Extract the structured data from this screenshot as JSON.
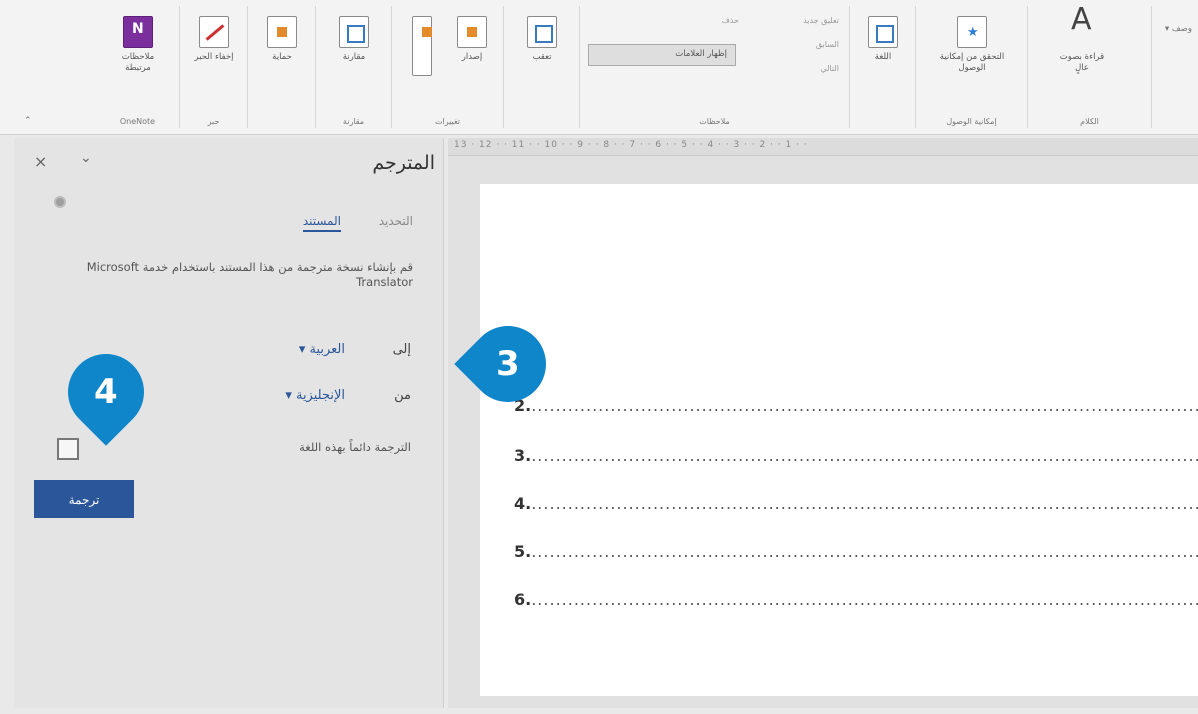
{
  "ribbon": {
    "buttons": {
      "linked_notes": "ملاحظات مرتبطة",
      "hide_ink": "إخفاء الحبر",
      "protect": "حماية",
      "compare": "مقارنة",
      "versions": "إصدار",
      "check": "تعقب",
      "language": "اللغة",
      "accessibility_check": "التحقق من إمكانية الوصول",
      "read_aloud": "قراءة بصوت عالٍ"
    },
    "filter_dropdown": "إظهار العلامات",
    "small_items": [
      "تعليق جديد",
      "حذف",
      "السابق",
      "التالي"
    ],
    "group_labels": {
      "onenote": "OneNote",
      "ink": "حبر",
      "compare": "مقارنة",
      "changes": "تغييرات",
      "comments": "ملاحظات",
      "accessibility": "إمكانية الوصول",
      "speech": "الكلام"
    },
    "more": "وصف ▾"
  },
  "pane": {
    "title": "المترجم",
    "close_icon": "×",
    "chevron_icon": "⌄",
    "tabs": {
      "document": "المستند",
      "selection": "التحديد"
    },
    "description": "قم بإنشاء نسخة مترجمة من هذا المستند باستخدام خدمة Microsoft Translator",
    "to_label": "إلى",
    "to_value": "العربية ▾",
    "from_label": "من",
    "from_value": "الإنجليزية ▾",
    "always_translate": "الترجمة دائماً بهذه اللغة",
    "translate_button": "ترجمة"
  },
  "ruler": {
    "ticks": "13 · 12 · · 11 · · 10 · · 9 · · 8 · · 7 · · 6 · · 5 · · 4 · · 3 · · 2 · · 1 · ·"
  },
  "document": {
    "lines": [
      {
        "num": "2.",
        "dots": "........................................................................................................................"
      },
      {
        "num": "3.",
        "dots": "........................................................................................................................"
      },
      {
        "num": "4.",
        "dots": "........................................................................................................................"
      },
      {
        "num": "5.",
        "dots": "........................................................................................................................"
      },
      {
        "num": "6.",
        "dots": "........................................................................................................................"
      }
    ]
  },
  "callouts": {
    "three": "3",
    "four": "4"
  },
  "colors": {
    "accent": "#2b579a",
    "callout": "#0e86c9"
  }
}
